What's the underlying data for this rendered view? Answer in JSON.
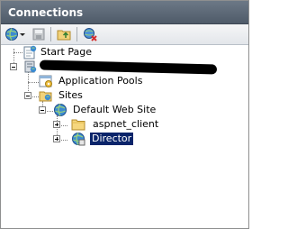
{
  "panel": {
    "title": "Connections"
  },
  "toolbar": {
    "buttons": [
      {
        "name": "connect-globe-icon"
      },
      {
        "name": "save-icon"
      },
      {
        "name": "up-folder-icon"
      },
      {
        "name": "disconnect-icon"
      }
    ]
  },
  "tree": {
    "start_page": "Start Page",
    "server": "",
    "app_pools": "Application Pools",
    "sites": "Sites",
    "default_site": "Default Web Site",
    "aspnet_client": "aspnet_client",
    "director": "Director"
  },
  "colors": {
    "header_bg": "#5a6573",
    "selection_bg": "#0a246a"
  }
}
